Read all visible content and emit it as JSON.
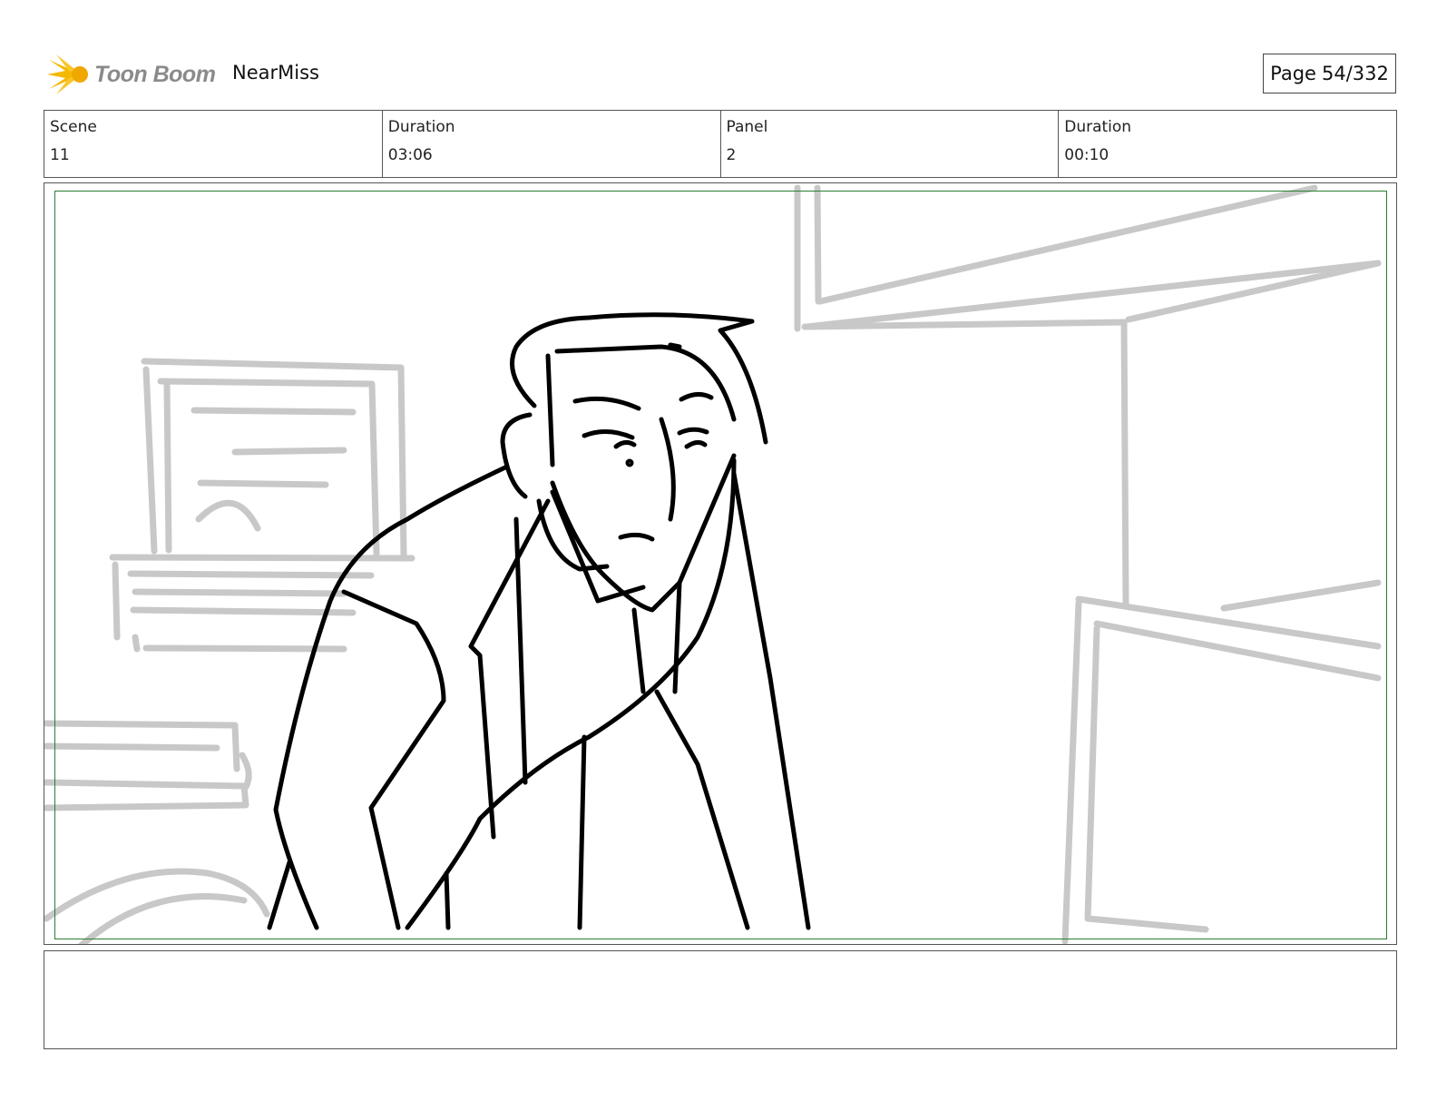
{
  "header": {
    "brand": "Toon Boom",
    "project_title": "NearMiss",
    "page_label": "Page",
    "page_number": "54/332"
  },
  "info": [
    {
      "label": "Scene",
      "value": "11"
    },
    {
      "label": "Duration",
      "value": "03:06"
    },
    {
      "label": "Panel",
      "value": "2"
    },
    {
      "label": "Duration",
      "value": "00:10"
    }
  ],
  "colors": {
    "safe_frame": "#2e7d32",
    "background_sketch": "#c8c8c8",
    "character_lines": "#000000",
    "logo_accent": "#f5b800"
  },
  "dialogue": ""
}
